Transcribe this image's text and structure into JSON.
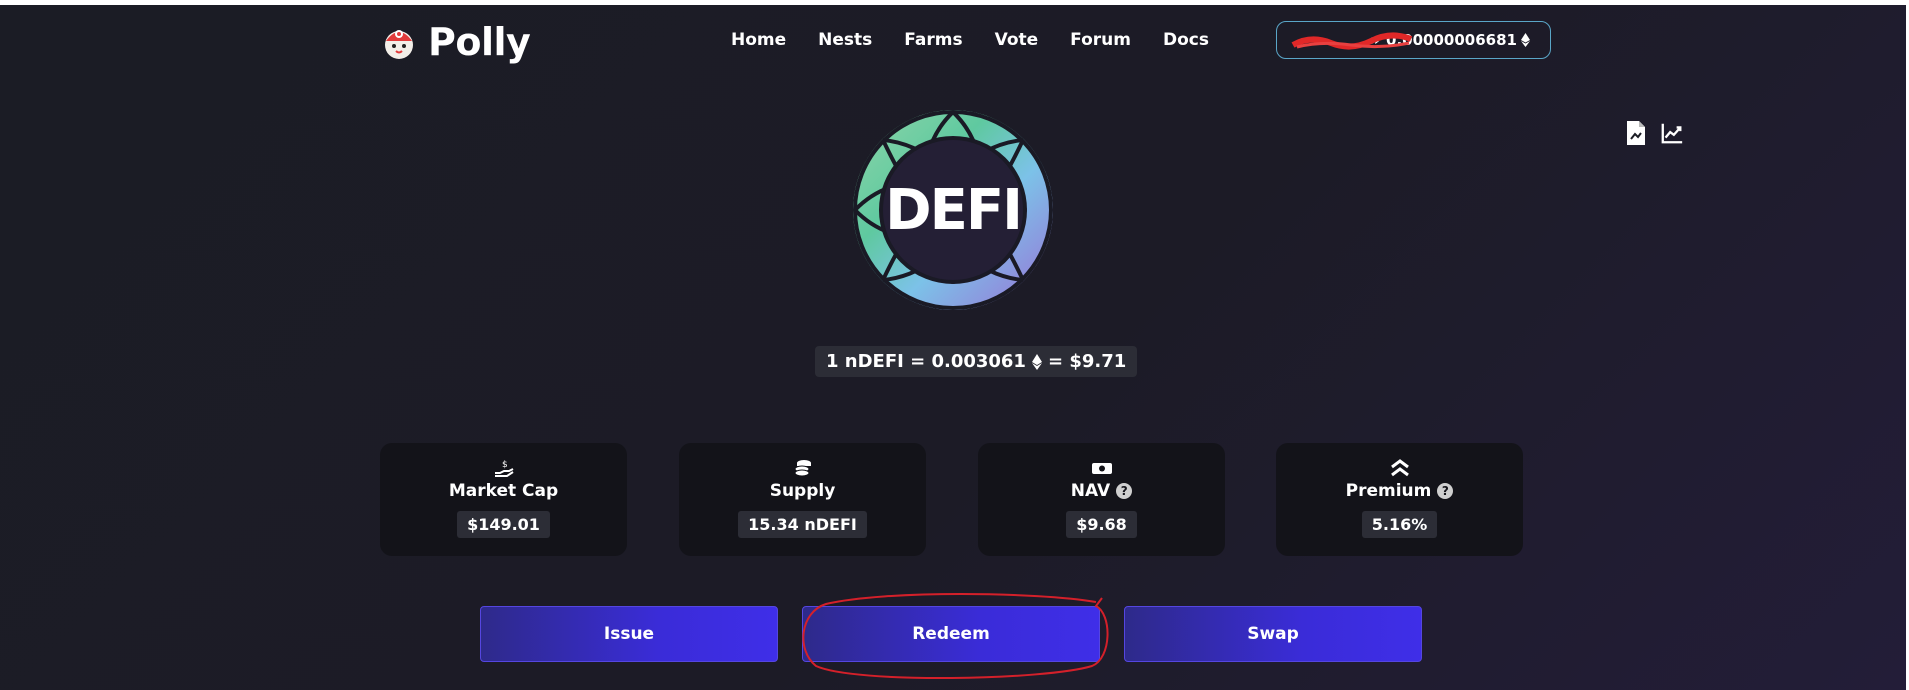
{
  "brand": {
    "name": "Polly"
  },
  "nav": [
    "Home",
    "Nests",
    "Farms",
    "Vote",
    "Forum",
    "Docs"
  ],
  "wallet": {
    "balance": "0.00000006681",
    "currency_icon": "eth-icon",
    "address_redacted": true
  },
  "token": {
    "logo_text": "DEFI"
  },
  "price": {
    "left": "1 nDEFI = 0.003061",
    "right": "= $9.71"
  },
  "stats": [
    {
      "icon": "hand-coin-icon",
      "title": "Market Cap",
      "value": "$149.01",
      "help": false
    },
    {
      "icon": "coins-stack-icon",
      "title": "Supply",
      "value": "15.34 nDEFI",
      "help": false
    },
    {
      "icon": "money-bill-icon",
      "title": "NAV",
      "value": "$9.68",
      "help": true
    },
    {
      "icon": "double-chevron-up-icon",
      "title": "Premium",
      "value": "5.16%",
      "help": true
    }
  ],
  "actions": {
    "issue": "Issue",
    "redeem": "Redeem",
    "swap": "Swap"
  },
  "colors": {
    "accent": "#3f2ee8",
    "annotation": "#d4202a",
    "wallet_border": "#5aa6c8"
  }
}
